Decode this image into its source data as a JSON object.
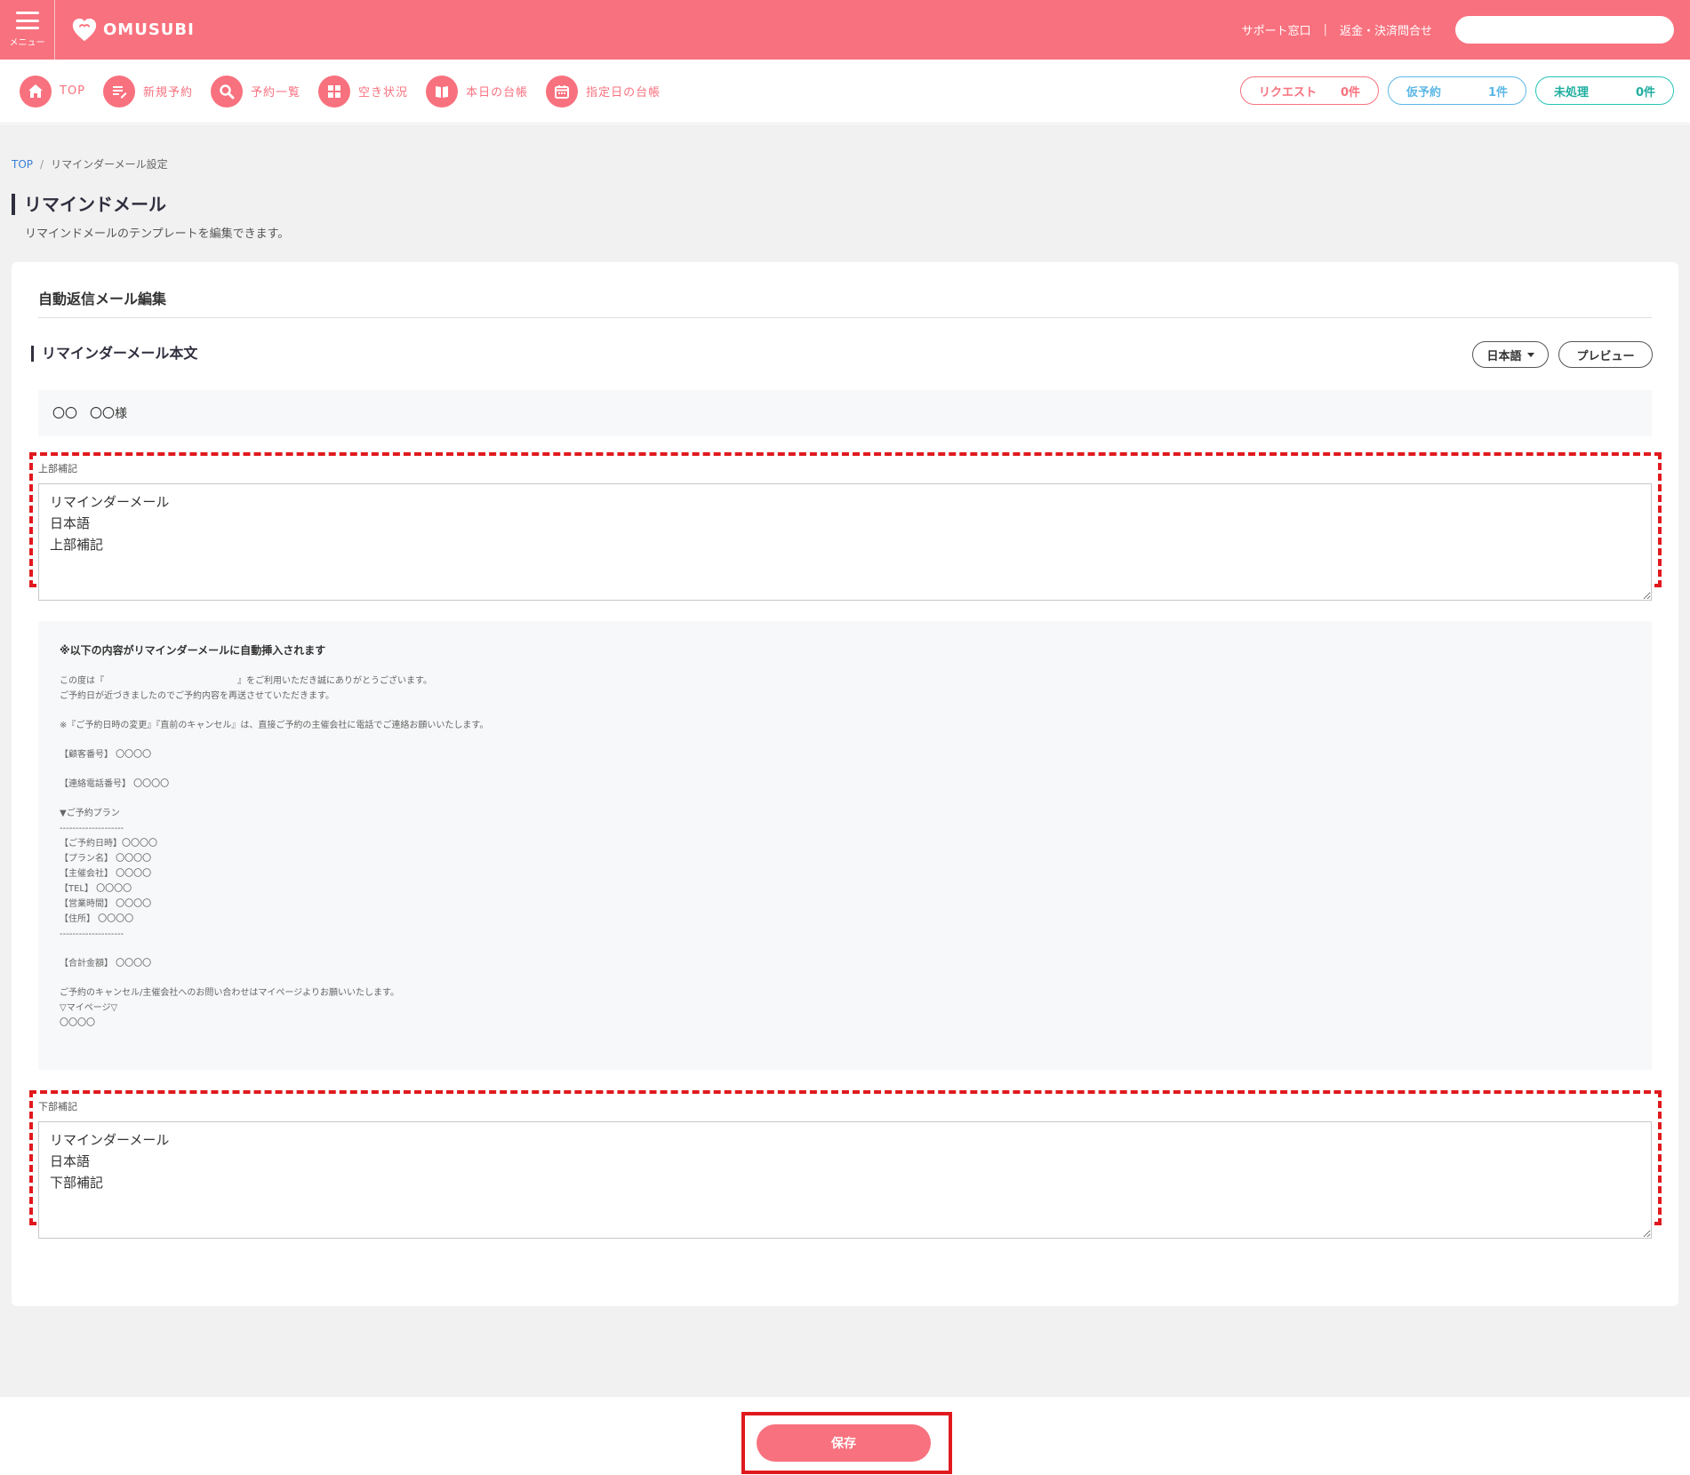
{
  "header": {
    "menu_label": "メニュー",
    "logo_text": "OMUSUBI",
    "links": [
      "サポート窓口",
      "返金・決済問合せ"
    ],
    "link_separator": "|",
    "search_placeholder": ""
  },
  "nav": {
    "items": [
      {
        "label": "TOP",
        "icon": "home-icon"
      },
      {
        "label": "新規予約",
        "icon": "new-reservation-icon"
      },
      {
        "label": "予約一覧",
        "icon": "search-icon"
      },
      {
        "label": "空き状況",
        "icon": "grid-icon"
      },
      {
        "label": "本日の台帳",
        "icon": "book-icon"
      },
      {
        "label": "指定日の台帳",
        "icon": "calendar-icon"
      }
    ],
    "pills": [
      {
        "label": "リクエスト",
        "count": "0件",
        "color": "#f8717e"
      },
      {
        "label": "仮予約",
        "count": "1件",
        "color": "#5bb7e6"
      },
      {
        "label": "未処理",
        "count": "0件",
        "color": "#25c3b6"
      }
    ]
  },
  "breadcrumb": {
    "home": "TOP",
    "separator": "/",
    "current": "リマインダーメール設定"
  },
  "page": {
    "title": "リマインドメール",
    "subtitle": "リマインドメールのテンプレートを編集できます。"
  },
  "card": {
    "title": "自動返信メール編集",
    "section_title": "リマインダーメール本文",
    "lang_button": "日本語",
    "preview_button": "プレビュー",
    "customer_name": "〇〇　〇〇様",
    "upper_note": {
      "label": "上部補記",
      "value": "リマインダーメール\n日本語\n上部補記"
    },
    "lower_note": {
      "label": "下部補記",
      "value": "リマインダーメール\n日本語\n下部補記"
    },
    "auto_insert": {
      "heading": "※以下の内容がリマインダーメールに自動挿入されます",
      "lines": [
        "この度は『　　　　　　　　　　　　　　　』をご利用いただき誠にありがとうございます。",
        "ご予約日が近づきましたのでご予約内容を再送させていただきます。",
        "",
        "※『ご予約日時の変更』『直前のキャンセル』は、直接ご予約の主催会社に電話でご連絡お願いいたします。",
        "",
        "【顧客番号】 〇〇〇〇",
        "",
        "【連絡電話番号】 〇〇〇〇",
        "",
        "▼ご予約プラン",
        "--------------------",
        "【ご予約日時】〇〇〇〇",
        "【プラン名】 〇〇〇〇",
        "【主催会社】 〇〇〇〇",
        "【TEL】 〇〇〇〇",
        "【営業時間】 〇〇〇〇",
        "【住所】 〇〇〇〇",
        "--------------------",
        "",
        "【合計金額】 〇〇〇〇",
        "",
        "ご予約のキャンセル/主催会社へのお問い合わせはマイページよりお願いいたします。",
        "▽マイページ▽",
        "〇〇〇〇"
      ]
    }
  },
  "footer": {
    "save_label": "保存"
  },
  "colors": {
    "brand": "#f8717e",
    "highlight": "#e0191e"
  }
}
